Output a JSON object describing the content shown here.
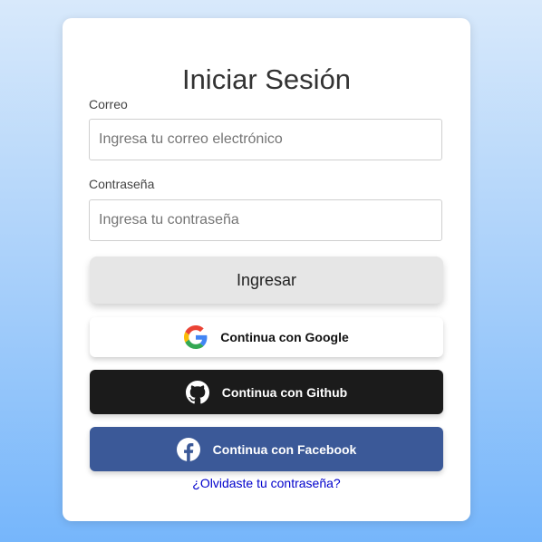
{
  "page_title": "Iniciar Sesión",
  "form": {
    "email_label": "Correo",
    "email_placeholder": "Ingresa tu correo electrónico",
    "email_value": "",
    "password_label": "Contraseña",
    "password_placeholder": "Ingresa tu contraseña",
    "password_value": "",
    "submit_label": "Ingresar"
  },
  "social": {
    "google_label": "Continua con Google",
    "github_label": "Continua con Github",
    "facebook_label": "Continua con Facebook",
    "google_icon": "google-icon",
    "github_icon": "github-icon",
    "facebook_icon": "facebook-icon"
  },
  "forgot_password": "¿Olvidaste tu contraseña?",
  "colors": {
    "background_top": "#d8e9fb",
    "background_bottom": "#76b6fb",
    "login_button": "#e6e6e6",
    "github_button": "#1b1b1b",
    "facebook_button": "#3b5998",
    "link": "#0000cc"
  }
}
